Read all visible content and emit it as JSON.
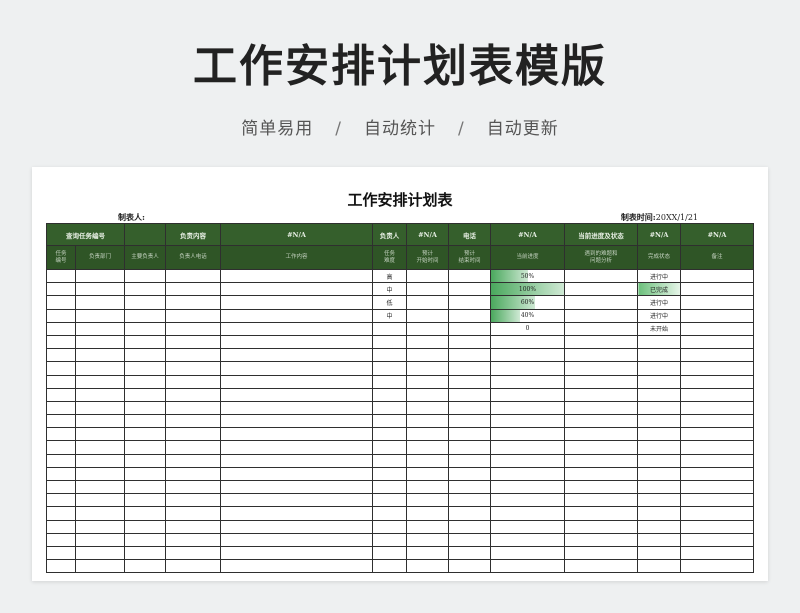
{
  "banner": {
    "title": "工作安排计划表模版",
    "features": [
      "简单易用",
      "自动统计",
      "自动更新"
    ],
    "separator": "/"
  },
  "sheet": {
    "title": "工作安排计划表",
    "maker_label": "制表人:",
    "time_label": "制表时间:",
    "time_value": "20XX/1/21"
  },
  "table": {
    "header_row1": [
      "查询任务编号",
      "",
      "负责内容",
      "#N/A",
      "负责人",
      "#N/A",
      "电话",
      "#N/A",
      "当前进度及状态",
      "#N/A",
      "#N/A"
    ],
    "header_row2": [
      "任务\n编号",
      "负责部门",
      "主要负责人",
      "负责人电话",
      "工作内容",
      "任务\n难度",
      "预计\n开始时间",
      "预计\n结束时间",
      "当前进度",
      "遇到的难题和\n问题分析",
      "完成状态",
      "备注"
    ],
    "rows": [
      {
        "difficulty": "高",
        "progress": "50%",
        "progress_value": 0.5,
        "status": "进行中"
      },
      {
        "difficulty": "中",
        "progress": "100%",
        "progress_value": 1.0,
        "status": "已完成"
      },
      {
        "difficulty": "低",
        "progress": "60%",
        "progress_value": 0.6,
        "status": "进行中"
      },
      {
        "difficulty": "中",
        "progress": "40%",
        "progress_value": 0.4,
        "status": "进行中"
      },
      {
        "difficulty": "",
        "progress": "0",
        "progress_value": 0,
        "status": "未开始"
      }
    ],
    "empty_row_count": 18
  },
  "colors": {
    "header_bg": "#355f2c",
    "progress_bar": "#4aa85d",
    "done_status": "#6cc07c"
  }
}
